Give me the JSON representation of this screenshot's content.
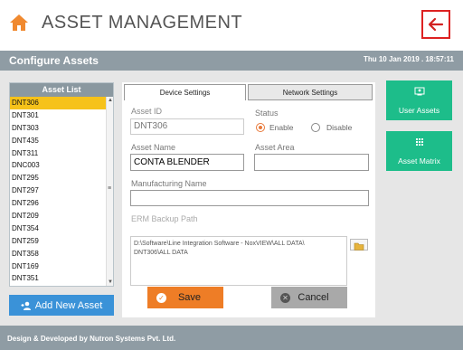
{
  "header": {
    "title": "ASSET MANAGEMENT",
    "home_icon": "home-icon",
    "back_icon": "back-arrow-icon",
    "colors": {
      "home": "#f0892f",
      "back": "#d22222"
    }
  },
  "subheader": {
    "title": "Configure Assets",
    "datetime": "Thu 10 Jan 2019 . 18:57:11"
  },
  "asset_list": {
    "title": "Asset List",
    "items": [
      "DNT306",
      "DNT301",
      "DNT303",
      "DNT435",
      "DNT311",
      "DNC003",
      "DNT295",
      "DNT297",
      "DNT296",
      "DNT209",
      "DNT354",
      "DNT259",
      "DNT358",
      "DNT169",
      "DNT351"
    ],
    "selected": "DNT306"
  },
  "add_button": {
    "label": "Add New Asset"
  },
  "tabs": {
    "device": "Device Settings",
    "network": "Network Settings",
    "active": "Device Settings"
  },
  "form": {
    "asset_id_label": "Asset ID",
    "asset_id_value": "DNT306",
    "status_label": "Status",
    "status_enable": "Enable",
    "status_disable": "Disable",
    "status_selected": "Enable",
    "asset_name_label": "Asset Name",
    "asset_name_value": "CONTA BLENDER",
    "asset_area_label": "Asset Area",
    "asset_area_value": "",
    "mfg_name_label": "Manufacturing Name",
    "mfg_name_value": "",
    "erm_label": "ERM Backup Path",
    "erm_value_line1": "D:\\Software\\Line Integration Software - NoxVIEW\\ALL DATA\\",
    "erm_value_line2": "DNT306\\ALL DATA"
  },
  "actions": {
    "save": "Save",
    "cancel": "Cancel"
  },
  "side": {
    "user_assets": "User Assets",
    "asset_matrix": "Asset Matrix"
  },
  "footer": {
    "text": "Design & Developed by Nutron Systems Pvt. Ltd."
  }
}
